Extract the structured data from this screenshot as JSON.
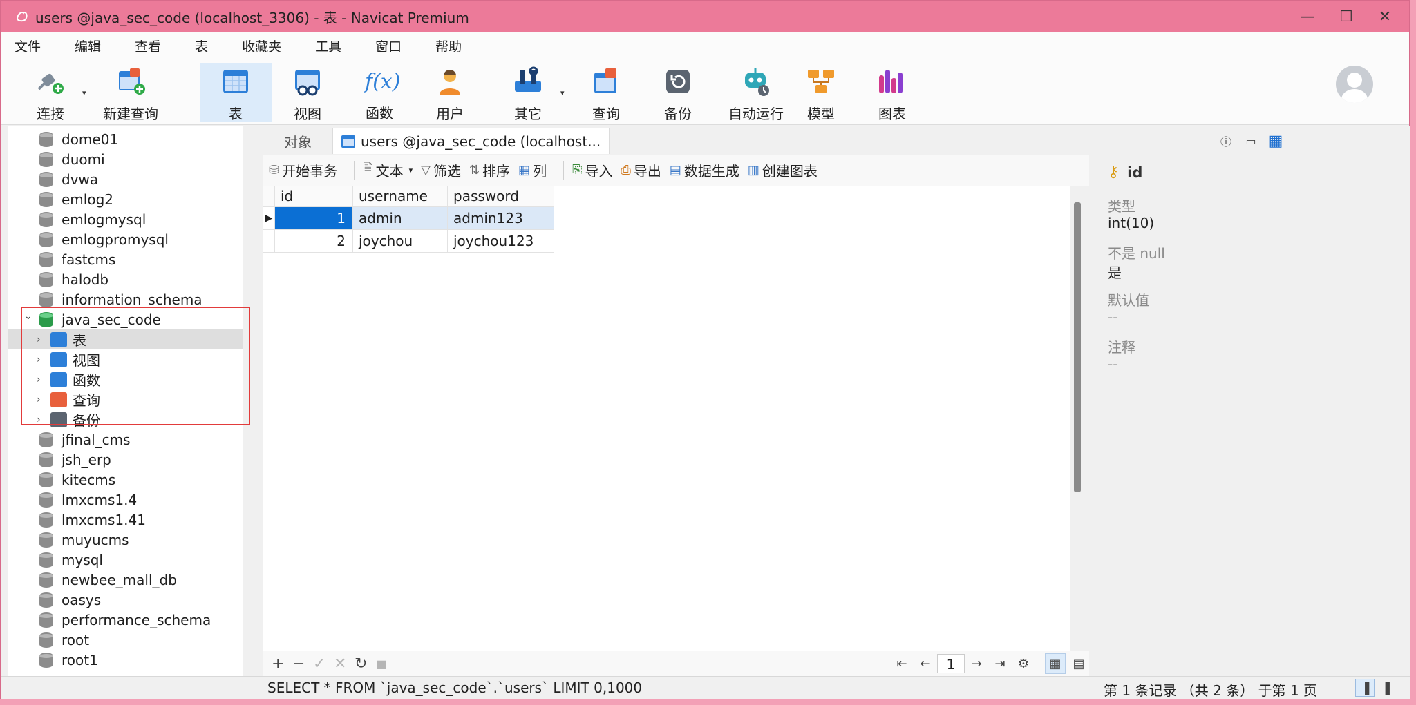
{
  "window": {
    "title": "users @java_sec_code (localhost_3306) - 表 - Navicat Premium",
    "app_icon": "navicat-icon",
    "minimize": "—",
    "maximize": "☐",
    "close": "✕"
  },
  "menu": [
    "文件",
    "编辑",
    "查看",
    "表",
    "收藏夹",
    "工具",
    "窗口",
    "帮助"
  ],
  "toolbar": {
    "items": [
      {
        "label": "连接",
        "icon": "connect-plug-icon"
      },
      {
        "label": "新建查询",
        "icon": "new-query-icon"
      },
      {
        "label": "表",
        "icon": "table-icon"
      },
      {
        "label": "视图",
        "icon": "view-icon"
      },
      {
        "label": "函数",
        "icon": "function-icon"
      },
      {
        "label": "用户",
        "icon": "user-icon"
      },
      {
        "label": "其它",
        "icon": "tools-icon"
      },
      {
        "label": "查询",
        "icon": "query-icon"
      },
      {
        "label": "备份",
        "icon": "backup-icon"
      },
      {
        "label": "自动运行",
        "icon": "robot-icon"
      },
      {
        "label": "模型",
        "icon": "model-icon"
      },
      {
        "label": "图表",
        "icon": "chart-icon"
      }
    ],
    "function_glyph": "f(x)"
  },
  "tree": {
    "databases_before": [
      "dome01",
      "duomi",
      "dvwa",
      "emlog2",
      "emlogmysql",
      "emlogpromysql",
      "fastcms",
      "halodb",
      "information_schema"
    ],
    "expanded_db": "java_sec_code",
    "children": [
      "表",
      "视图",
      "函数",
      "查询",
      "备份"
    ],
    "databases_after": [
      "jfinal_cms",
      "jsh_erp",
      "kitecms",
      "lmxcms1.4",
      "lmxcms1.41",
      "muyucms",
      "mysql",
      "newbee_mall_db",
      "oasys",
      "performance_schema",
      "root",
      "root1"
    ]
  },
  "tabs": {
    "objects": "对象",
    "active": "users @java_sec_code (localhost..."
  },
  "actions": {
    "begin_tx": "开始事务",
    "text": "文本",
    "filter": "筛选",
    "sort": "排序",
    "columns": "列",
    "import": "导入",
    "export": "导出",
    "data_gen": "数据生成",
    "create_chart": "创建图表"
  },
  "grid": {
    "columns": [
      "id",
      "username",
      "password"
    ],
    "rows": [
      [
        "1",
        "admin",
        "admin123"
      ],
      [
        "2",
        "joychou",
        "joychou123"
      ]
    ]
  },
  "bottom": {
    "add": "+",
    "remove": "−",
    "apply": "✓",
    "discard": "✕",
    "refresh": "↻",
    "stop": "■",
    "page": "1",
    "first": "⇤",
    "prev": "←",
    "next": "→",
    "last": "⇥",
    "settings": "⚙"
  },
  "status": {
    "sql": "SELECT * FROM `java_sec_code`.`users` LIMIT 0,1000",
    "record": "第 1 条记录 （共 2 条） 于第 1 页"
  },
  "right_panel": {
    "field_name": "id",
    "type_label": "类型",
    "type_value": "int(10)",
    "notnull_label": "不是 null",
    "notnull_value": "是",
    "default_label": "默认值",
    "default_value": "--",
    "comment_label": "注释",
    "comment_value": "--"
  }
}
